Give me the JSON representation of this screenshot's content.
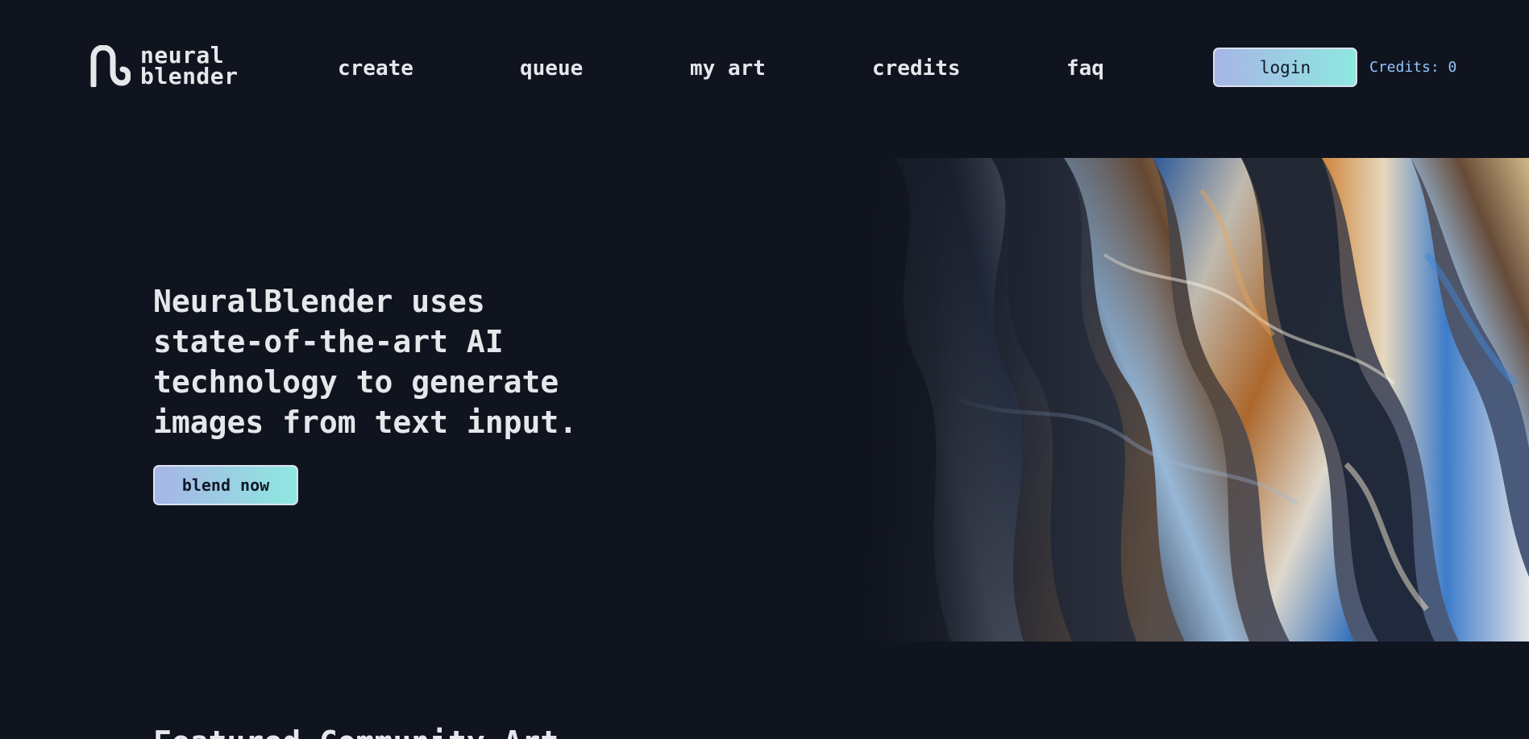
{
  "brand": {
    "line1": "neural",
    "line2": "blender",
    "logo_icon": "neural-blender-wave-logo"
  },
  "nav": {
    "items": [
      {
        "label": "create"
      },
      {
        "label": "queue"
      },
      {
        "label": "my art"
      },
      {
        "label": "credits"
      },
      {
        "label": "faq"
      }
    ]
  },
  "header": {
    "login_label": "login",
    "credits_text": "Credits: 0"
  },
  "hero": {
    "title": "NeuralBlender uses\nstate-of-the-art AI\ntechnology to generate\nimages from text input.",
    "cta_label": "blend now",
    "image_description_icon": "iridescent-abstract-waves-image"
  },
  "featured": {
    "title": "Featured Community Art"
  },
  "colors": {
    "background": "#10141f",
    "text": "#e5e7eb",
    "button_gradient_start": "#a7b5e6",
    "button_gradient_end": "#8ee8e0",
    "credits_text": "#93c5fd"
  }
}
